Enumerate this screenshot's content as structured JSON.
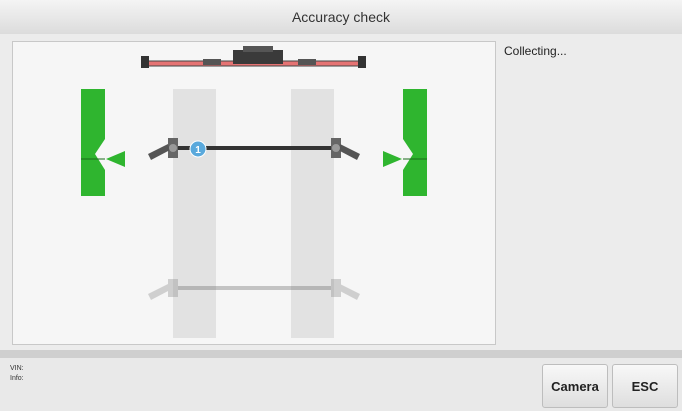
{
  "window": {
    "title": "Accuracy check"
  },
  "status": {
    "text": "Collecting..."
  },
  "diagram": {
    "marker_number": "1"
  },
  "footer": {
    "vin_label": "VIN:",
    "info_label": "Info:"
  },
  "buttons": {
    "camera": "Camera",
    "esc": "ESC"
  },
  "colors": {
    "target_green": "#2fb52f",
    "marker_blue": "#5aa9dc",
    "lift_red": "#e57373"
  }
}
